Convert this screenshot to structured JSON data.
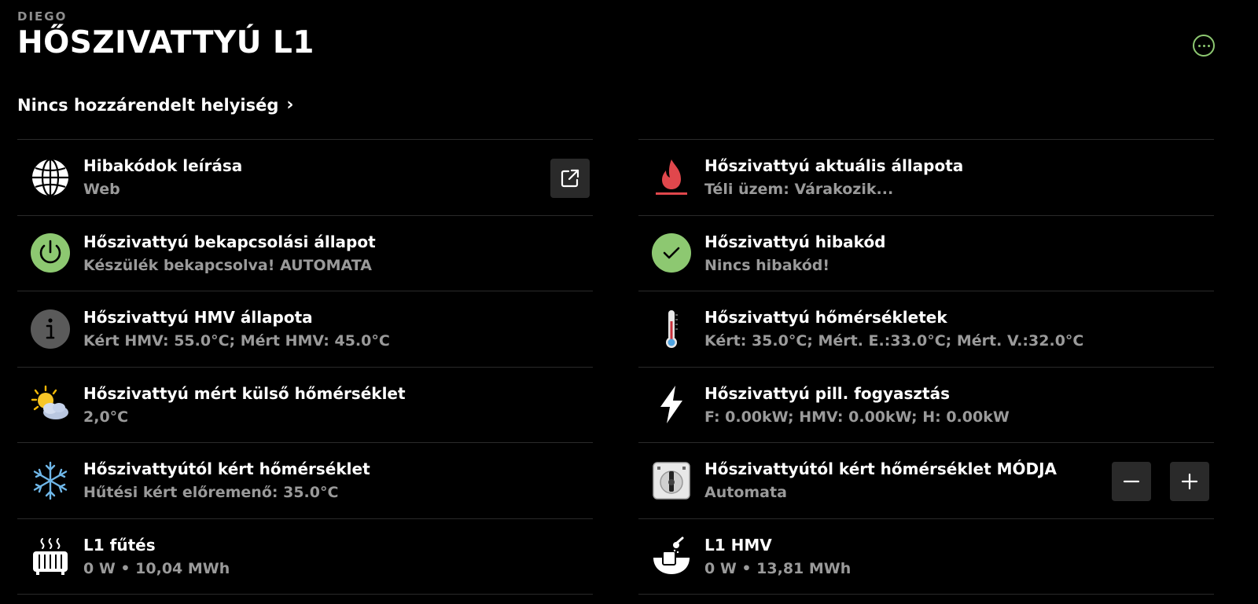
{
  "header": {
    "owner": "DIEGO",
    "title": "HŐSZIVATTYÚ L1"
  },
  "room_link": {
    "label": "Nincs hozzárendelt helyiség"
  },
  "left_rows": [
    {
      "primary": "Hibakódok leírása",
      "secondary": "Web",
      "icon": "globe-icon"
    },
    {
      "primary": "Hőszivattyú bekapcsolási állapot",
      "secondary": "Készülék bekapcsolva! AUTOMATA",
      "icon": "power-icon"
    },
    {
      "primary": "Hőszivattyú HMV állapota",
      "secondary": "Kért HMV: 55.0°C; Mért HMV: 45.0°C",
      "icon": "info-icon"
    },
    {
      "primary": "Hőszivattyú mért külső hőmérséklet",
      "secondary": "2,0°C",
      "icon": "weather-icon"
    },
    {
      "primary": "Hőszivattyútól kért hőmérséklet",
      "secondary": "Hűtési kért előremenő: 35.0°C",
      "icon": "snowflake-icon"
    },
    {
      "primary": "L1 fűtés",
      "secondary": "0 W • 10,04 MWh",
      "icon": "radiator-icon"
    }
  ],
  "right_rows": [
    {
      "primary": "Hőszivattyú aktuális állapota",
      "secondary": "Téli üzem: Várakozik...",
      "icon": "flame-icon"
    },
    {
      "primary": "Hőszivattyú hibakód",
      "secondary": "Nincs hibakód!",
      "icon": "check-icon"
    },
    {
      "primary": "Hőszivattyú hőmérsékletek",
      "secondary": "Kért: 35.0°C; Mért. E.:33.0°C; Mért. V.:32.0°C",
      "icon": "thermometer-icon"
    },
    {
      "primary": "Hőszivattyú pill. fogyasztás",
      "secondary": "F: 0.00kW; HMV: 0.00kW; H: 0.00kW",
      "icon": "lightning-icon"
    },
    {
      "primary": "Hőszivattyútól kért hőmérséklet MÓDJA",
      "secondary": "Automata",
      "icon": "rotary-switch-icon"
    },
    {
      "primary": "L1 HMV",
      "secondary": "0 W • 13,81 MWh",
      "icon": "water-heater-icon"
    }
  ],
  "colors": {
    "background": "#000000",
    "accent_green": "#8dc871",
    "flame_red": "#e0474c",
    "secondary_text": "#9a9a9a",
    "divider": "#2a2a2a",
    "button_bg": "#2a2a2a"
  }
}
